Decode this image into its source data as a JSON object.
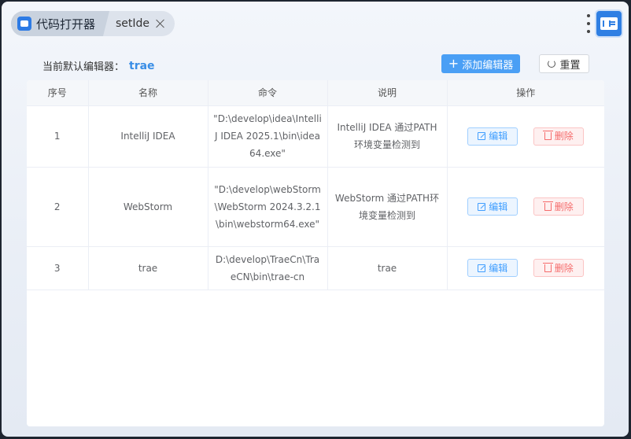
{
  "window": {
    "app_tab_label": "代码打开器",
    "second_tab_label": "setIde"
  },
  "toolbar": {
    "default_label": "当前默认编辑器：",
    "default_value": "trae",
    "add_label": "添加编辑器",
    "reset_label": "重置"
  },
  "table": {
    "headers": [
      "序号",
      "名称",
      "命令",
      "说明",
      "操作"
    ],
    "rows": [
      {
        "index": "1",
        "name": "IntelliJ IDEA",
        "command": "\"D:\\develop\\idea\\IntelliJ IDEA 2025.1\\bin\\idea64.exe\"",
        "description": "IntelliJ IDEA 通过PATH环境变量检测到"
      },
      {
        "index": "2",
        "name": "WebStorm",
        "command": "\"D:\\develop\\webStorm\\WebStorm 2024.3.2.1\\bin\\webstorm64.exe\"",
        "description": "WebStorm 通过PATH环境变量检测到"
      },
      {
        "index": "3",
        "name": "trae",
        "command": "D:\\develop\\TraeCn\\TraeCN\\bin\\trae-cn",
        "description": "trae"
      }
    ],
    "edit_label": "编辑",
    "delete_label": "删除"
  },
  "colors": {
    "accent": "#4a9ff5",
    "default_value": "#3a8ee6",
    "edit": "#409eff",
    "delete": "#f56c6c"
  }
}
